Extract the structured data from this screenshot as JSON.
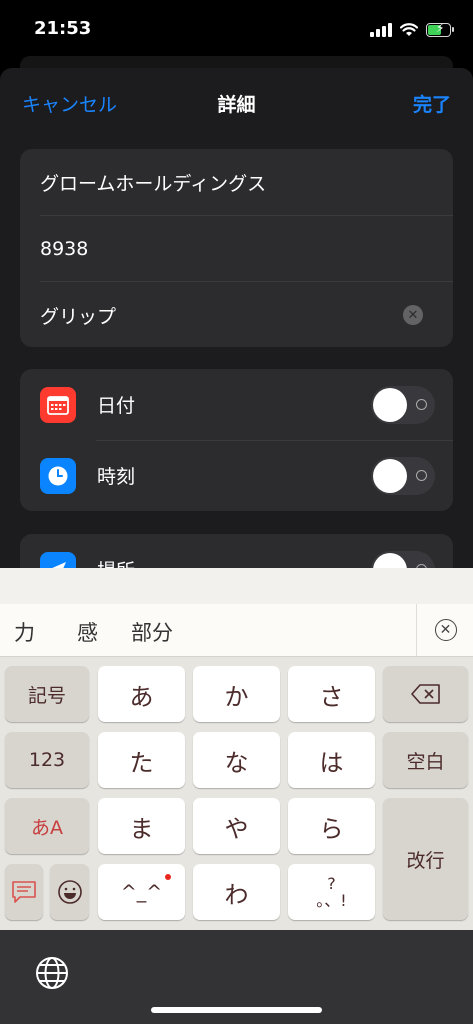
{
  "status_bar": {
    "time": "21:53"
  },
  "nav": {
    "cancel": "キャンセル",
    "title": "詳細",
    "done": "完了"
  },
  "fields": {
    "name": "グロームホールディングス",
    "code": "8938",
    "memo": "グリップ"
  },
  "toggles": [
    {
      "label": "日付",
      "icon": "calendar-icon",
      "icon_color": "#ff3b30",
      "on": false
    },
    {
      "label": "時刻",
      "icon": "clock-icon",
      "icon_color": "#0a84ff",
      "on": false
    },
    {
      "label": "場所",
      "icon": "location-icon",
      "icon_color": "#0a84ff",
      "on": false
    }
  ],
  "candidates": [
    "力",
    "感",
    "部分"
  ],
  "keyboard": {
    "symbols": "記号",
    "numbers": "123",
    "mode": "あA",
    "row1": [
      "あ",
      "か",
      "さ"
    ],
    "row2": [
      "た",
      "な",
      "は"
    ],
    "row3": [
      "ま",
      "や",
      "ら"
    ],
    "row4": [
      "^_^",
      "わ",
      "?\n。、!"
    ],
    "space": "空白",
    "enter": "改行"
  },
  "colors": {
    "accent": "#1a84ff",
    "background": "#1c1c1e",
    "cell": "#2c2c2e"
  }
}
